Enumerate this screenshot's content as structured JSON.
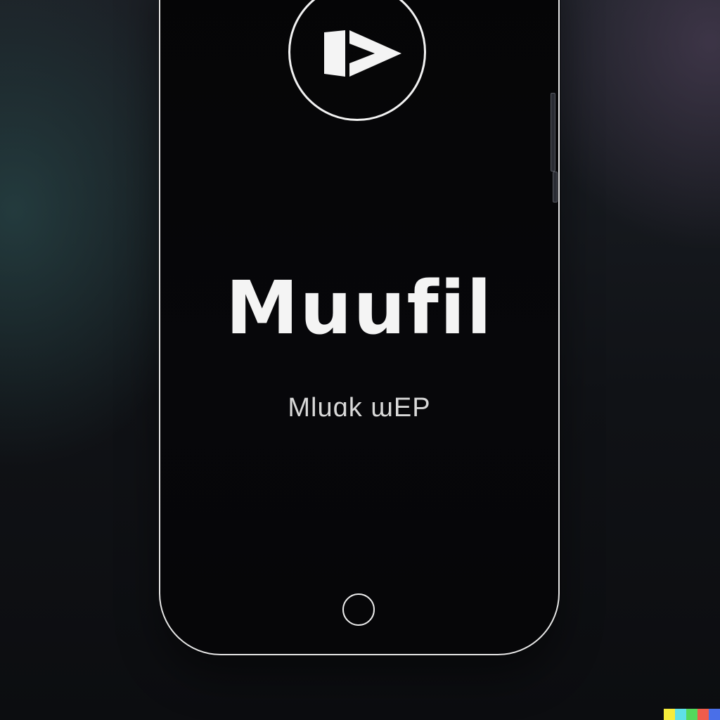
{
  "screen": {
    "title": "Muufil",
    "subtitle": "Mluɑk ɯEP"
  },
  "icons": {
    "play": "play-icon",
    "home": "home-button-icon"
  },
  "colors": {
    "screen": "#050506",
    "frame": "#e6e6e6",
    "text": "#f4f4f4"
  },
  "color_strip": [
    "#f5ec3c",
    "#5fe0e8",
    "#55d85c",
    "#ef5c4c",
    "#4a6fe8"
  ]
}
